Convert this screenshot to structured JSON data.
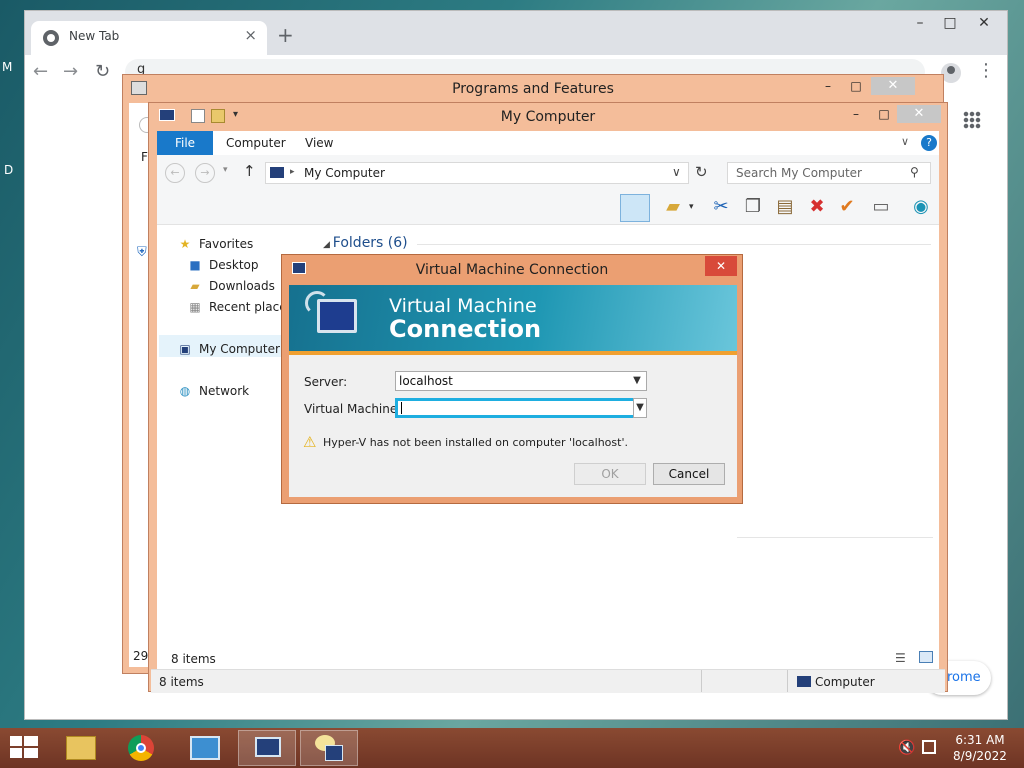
{
  "chrome": {
    "tab_title": "New Tab",
    "omnibox_text": "g",
    "customize_label": "rome",
    "edge_letter_top": "M",
    "edge_letter_bottom": "D"
  },
  "programs_features": {
    "title": "Programs and Features",
    "left_frag_1": "Fi",
    "left_frag_2": "29"
  },
  "my_computer": {
    "title": "My Computer",
    "tabs": {
      "file": "File",
      "computer": "Computer",
      "view": "View"
    },
    "address": "My Computer",
    "search_placeholder": "Search My Computer",
    "nav": {
      "favorites": "Favorites",
      "desktop": "Desktop",
      "downloads": "Downloads",
      "recent": "Recent places",
      "my_computer": "My Computer",
      "network": "Network"
    },
    "folders_group": "Folders (6)",
    "items_count_inner": "8 items",
    "items_count_outer": "8 items",
    "status_computer": "Computer"
  },
  "vm_dialog": {
    "title": "Virtual Machine Connection",
    "banner_line1": "Virtual Machine",
    "banner_line2": "Connection",
    "server_label": "Server:",
    "server_value": "localhost",
    "vm_label": "Virtual Machine:",
    "vm_value": "",
    "warning": "Hyper-V has not been installed on computer 'localhost'.",
    "ok": "OK",
    "cancel": "Cancel"
  },
  "taskbar": {
    "time": "6:31 AM",
    "date": "8/9/2022"
  },
  "colors": {
    "win8_frame": "#f4bd9a",
    "dialog_frame": "#eb9f72",
    "file_tab": "#1979ca",
    "taskbar": "#7a3c2a"
  }
}
